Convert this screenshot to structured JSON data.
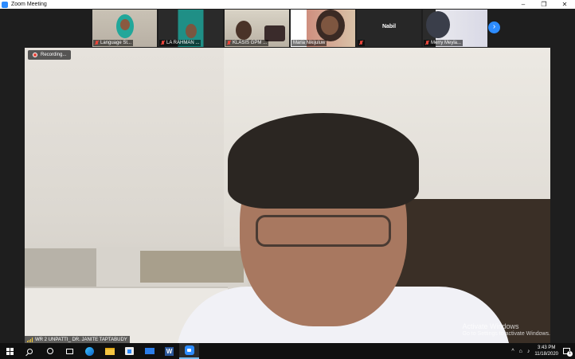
{
  "window": {
    "title": "Zoom Meeting",
    "controls": {
      "minimize": "–",
      "restore": "❐",
      "close": "✕"
    }
  },
  "participants": [
    {
      "name": "Language St...",
      "muted": true
    },
    {
      "name": "LA RAHMAN ...",
      "muted": true
    },
    {
      "name": "KLASIS GPM ...",
      "muted": true
    },
    {
      "name": "Maria Nikijuluw",
      "muted": false
    },
    {
      "name": "Nabil",
      "muted": true
    },
    {
      "name": "Merry Meyla...",
      "muted": true
    }
  ],
  "strip_next_icon": "›",
  "main_video": {
    "recording_label": "Recording...",
    "speaker_name": "WR 2 UNPATTI_ DR. JANITE TAPTABUDY",
    "watermark_line1": "Activate Windows",
    "watermark_line2": "Go to Settings to activate Windows."
  },
  "taskbar": {
    "time": "3:43 PM",
    "date": "11/18/2020",
    "notification_count": "1",
    "tray_symbols": {
      "chevron": "^",
      "network": "⌂",
      "volume": "♪"
    },
    "apps": [
      "start-icon",
      "search-icon",
      "cortana-icon",
      "task-view-icon",
      "edge-icon",
      "file-explorer-icon",
      "store-icon",
      "mail-icon",
      "word-icon",
      "zoom-icon"
    ]
  },
  "colors": {
    "accent": "#2d8cff",
    "muted_red": "#e8463c",
    "taskbar": "#101010"
  }
}
